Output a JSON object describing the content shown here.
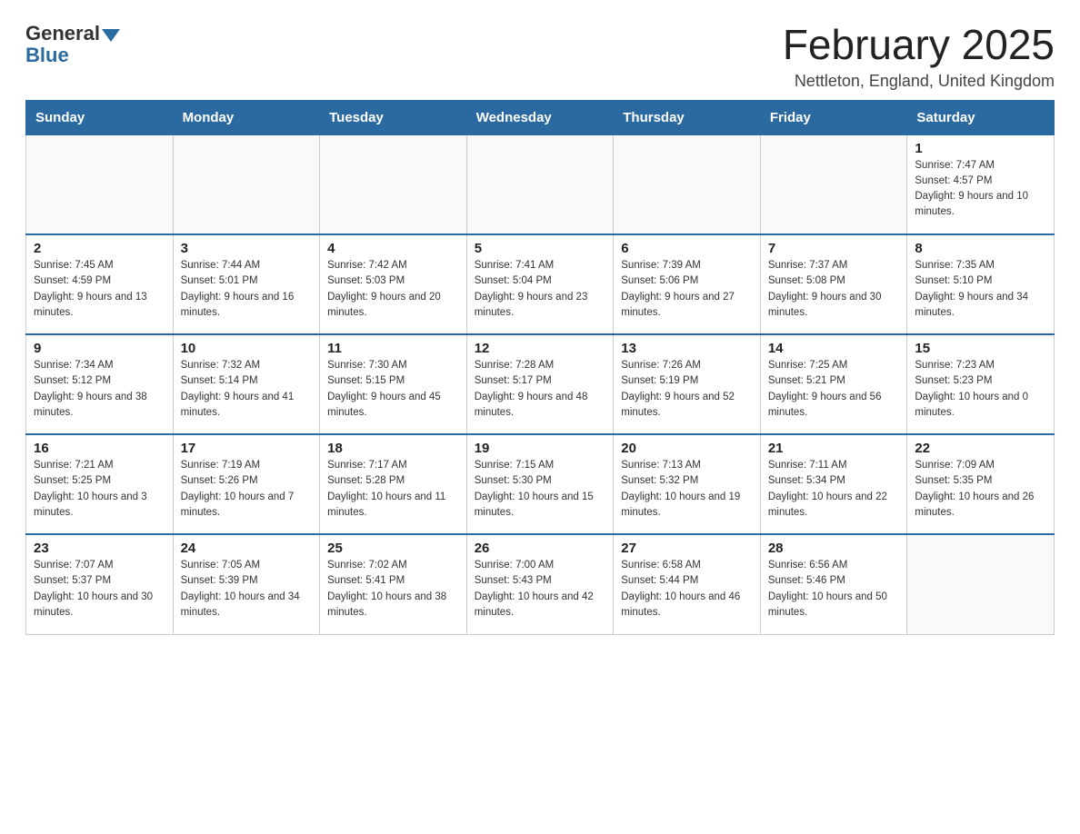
{
  "header": {
    "logo_general": "General",
    "logo_blue": "Blue",
    "month": "February 2025",
    "location": "Nettleton, England, United Kingdom"
  },
  "weekdays": [
    "Sunday",
    "Monday",
    "Tuesday",
    "Wednesday",
    "Thursday",
    "Friday",
    "Saturday"
  ],
  "weeks": [
    [
      {
        "day": "",
        "info": ""
      },
      {
        "day": "",
        "info": ""
      },
      {
        "day": "",
        "info": ""
      },
      {
        "day": "",
        "info": ""
      },
      {
        "day": "",
        "info": ""
      },
      {
        "day": "",
        "info": ""
      },
      {
        "day": "1",
        "info": "Sunrise: 7:47 AM\nSunset: 4:57 PM\nDaylight: 9 hours and 10 minutes."
      }
    ],
    [
      {
        "day": "2",
        "info": "Sunrise: 7:45 AM\nSunset: 4:59 PM\nDaylight: 9 hours and 13 minutes."
      },
      {
        "day": "3",
        "info": "Sunrise: 7:44 AM\nSunset: 5:01 PM\nDaylight: 9 hours and 16 minutes."
      },
      {
        "day": "4",
        "info": "Sunrise: 7:42 AM\nSunset: 5:03 PM\nDaylight: 9 hours and 20 minutes."
      },
      {
        "day": "5",
        "info": "Sunrise: 7:41 AM\nSunset: 5:04 PM\nDaylight: 9 hours and 23 minutes."
      },
      {
        "day": "6",
        "info": "Sunrise: 7:39 AM\nSunset: 5:06 PM\nDaylight: 9 hours and 27 minutes."
      },
      {
        "day": "7",
        "info": "Sunrise: 7:37 AM\nSunset: 5:08 PM\nDaylight: 9 hours and 30 minutes."
      },
      {
        "day": "8",
        "info": "Sunrise: 7:35 AM\nSunset: 5:10 PM\nDaylight: 9 hours and 34 minutes."
      }
    ],
    [
      {
        "day": "9",
        "info": "Sunrise: 7:34 AM\nSunset: 5:12 PM\nDaylight: 9 hours and 38 minutes."
      },
      {
        "day": "10",
        "info": "Sunrise: 7:32 AM\nSunset: 5:14 PM\nDaylight: 9 hours and 41 minutes."
      },
      {
        "day": "11",
        "info": "Sunrise: 7:30 AM\nSunset: 5:15 PM\nDaylight: 9 hours and 45 minutes."
      },
      {
        "day": "12",
        "info": "Sunrise: 7:28 AM\nSunset: 5:17 PM\nDaylight: 9 hours and 48 minutes."
      },
      {
        "day": "13",
        "info": "Sunrise: 7:26 AM\nSunset: 5:19 PM\nDaylight: 9 hours and 52 minutes."
      },
      {
        "day": "14",
        "info": "Sunrise: 7:25 AM\nSunset: 5:21 PM\nDaylight: 9 hours and 56 minutes."
      },
      {
        "day": "15",
        "info": "Sunrise: 7:23 AM\nSunset: 5:23 PM\nDaylight: 10 hours and 0 minutes."
      }
    ],
    [
      {
        "day": "16",
        "info": "Sunrise: 7:21 AM\nSunset: 5:25 PM\nDaylight: 10 hours and 3 minutes."
      },
      {
        "day": "17",
        "info": "Sunrise: 7:19 AM\nSunset: 5:26 PM\nDaylight: 10 hours and 7 minutes."
      },
      {
        "day": "18",
        "info": "Sunrise: 7:17 AM\nSunset: 5:28 PM\nDaylight: 10 hours and 11 minutes."
      },
      {
        "day": "19",
        "info": "Sunrise: 7:15 AM\nSunset: 5:30 PM\nDaylight: 10 hours and 15 minutes."
      },
      {
        "day": "20",
        "info": "Sunrise: 7:13 AM\nSunset: 5:32 PM\nDaylight: 10 hours and 19 minutes."
      },
      {
        "day": "21",
        "info": "Sunrise: 7:11 AM\nSunset: 5:34 PM\nDaylight: 10 hours and 22 minutes."
      },
      {
        "day": "22",
        "info": "Sunrise: 7:09 AM\nSunset: 5:35 PM\nDaylight: 10 hours and 26 minutes."
      }
    ],
    [
      {
        "day": "23",
        "info": "Sunrise: 7:07 AM\nSunset: 5:37 PM\nDaylight: 10 hours and 30 minutes."
      },
      {
        "day": "24",
        "info": "Sunrise: 7:05 AM\nSunset: 5:39 PM\nDaylight: 10 hours and 34 minutes."
      },
      {
        "day": "25",
        "info": "Sunrise: 7:02 AM\nSunset: 5:41 PM\nDaylight: 10 hours and 38 minutes."
      },
      {
        "day": "26",
        "info": "Sunrise: 7:00 AM\nSunset: 5:43 PM\nDaylight: 10 hours and 42 minutes."
      },
      {
        "day": "27",
        "info": "Sunrise: 6:58 AM\nSunset: 5:44 PM\nDaylight: 10 hours and 46 minutes."
      },
      {
        "day": "28",
        "info": "Sunrise: 6:56 AM\nSunset: 5:46 PM\nDaylight: 10 hours and 50 minutes."
      },
      {
        "day": "",
        "info": ""
      }
    ]
  ]
}
